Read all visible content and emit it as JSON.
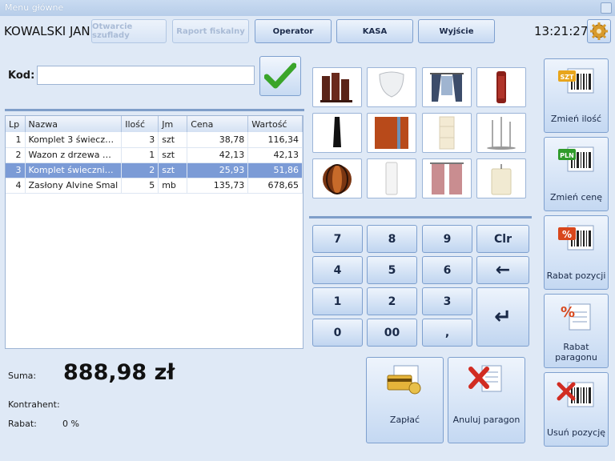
{
  "window": {
    "title": "Menu główne"
  },
  "header": {
    "user": "KOWALSKI JAN",
    "buttons": {
      "open_drawer": "Otwarcie szuflady",
      "fiscal_report": "Raport fiskalny",
      "operator": "Operator",
      "cash": "KASA",
      "exit": "Wyjście"
    },
    "clock": "13:21:27"
  },
  "code": {
    "label": "Kod:",
    "value": ""
  },
  "table": {
    "columns": [
      "Lp",
      "Nazwa",
      "Ilość",
      "Jm",
      "Cena",
      "Wartość"
    ],
    "rows": [
      [
        "1",
        "Komplet 3 świecz…",
        "3",
        "szt",
        "38,78",
        "116,34"
      ],
      [
        "2",
        "Wazon z drzewa …",
        "1",
        "szt",
        "42,13",
        "42,13"
      ],
      [
        "3",
        "Komplet świeczni…",
        "2",
        "szt",
        "25,93",
        "51,86"
      ],
      [
        "4",
        "Zasłony Alvine Smal",
        "5",
        "mb",
        "135,73",
        "678,65"
      ]
    ],
    "selected_row": 2
  },
  "keypad": {
    "keys": [
      "7",
      "8",
      "9",
      "Clr",
      "4",
      "5",
      "6",
      "←",
      "1",
      "2",
      "3",
      "↵",
      "0",
      "00",
      ","
    ]
  },
  "summary": {
    "sum_label": "Suma:",
    "sum_value": "888,98 zł",
    "contractor_label": "Kontrahent:",
    "discount_label": "Rabat:",
    "discount_value": "0 %"
  },
  "actions": {
    "pay": "Zapłać",
    "cancel_receipt": "Anuluj paragon"
  },
  "side": {
    "change_qty": "Zmień ilość",
    "change_price": "Zmień cenę",
    "line_discount": "Rabat pozycji",
    "receipt_discount": "Rabat paragonu",
    "remove_line": "Usuń pozycję",
    "qty_badge": "SZT",
    "price_badge": "PLN",
    "percent_badge": "%"
  },
  "colors": {
    "accent": "#7b9bd6",
    "background": "#dfe9f6",
    "ok_green": "#3aa52a",
    "delete_red": "#d12c22"
  }
}
